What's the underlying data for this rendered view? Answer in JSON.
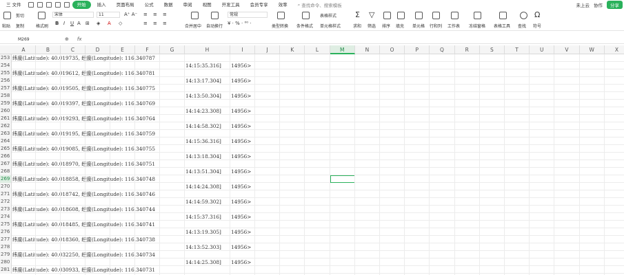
{
  "menu": {
    "items": [
      "三 文件",
      "开始",
      "插入",
      "页面布局",
      "公式",
      "数据",
      "审阅",
      "视图",
      "开发工具",
      "会员专享",
      "效率"
    ],
    "active_index": 1,
    "search_placeholder": "查找命令、搜索模板",
    "cloud": "未上云",
    "collab": "协作",
    "share": "分享"
  },
  "ribbon": {
    "paste": "粘贴",
    "cut": "剪切",
    "copy": "复制",
    "format_painter": "格式刷",
    "font_name": "宋体",
    "font_size": "11",
    "merge": "合并居中",
    "wrap": "自动换行",
    "number_format": "常规",
    "type_convert": "类型转换",
    "conditional_format": "条件格式",
    "table_style": "表格样式",
    "cell_style": "单元格样式",
    "sum": "求和",
    "filter": "筛选",
    "sort": "排序",
    "fill": "填充",
    "cell": "单元格",
    "row_col": "行和列",
    "worksheet": "工作表",
    "freeze": "冻结窗格",
    "table_tools": "表格工具",
    "find": "查找",
    "symbol": "符号"
  },
  "formula_bar": {
    "name_box": "M269",
    "fx": "fx",
    "value": ""
  },
  "columns": [
    "A",
    "B",
    "C",
    "D",
    "E",
    "F",
    "G",
    "H",
    "I",
    "J",
    "K",
    "L",
    "M",
    "N",
    "O",
    "P",
    "Q",
    "R",
    "S",
    "T",
    "U",
    "V",
    "W",
    "X"
  ],
  "selected_column": "M",
  "selected_row": "269",
  "rows": [
    {
      "n": "253",
      "a": "纬度(Latitude): 40.019735, 经度(Longitude): 116.340787",
      "h": "",
      "i": ""
    },
    {
      "n": "254",
      "a": "",
      "h": "14:15:35.316]",
      "i": "14956>"
    },
    {
      "n": "255",
      "a": "纬度(Latitude): 40.019612, 经度(Longitude): 116.340781",
      "h": "",
      "i": ""
    },
    {
      "n": "256",
      "a": "",
      "h": "14:13:17.304]",
      "i": "14956>"
    },
    {
      "n": "257",
      "a": "纬度(Latitude): 40.019505, 经度(Longitude): 116.340775",
      "h": "",
      "i": ""
    },
    {
      "n": "258",
      "a": "",
      "h": "14:13:50.304]",
      "i": "14956>"
    },
    {
      "n": "259",
      "a": "纬度(Latitude): 40.019397, 经度(Longitude): 116.340769",
      "h": "",
      "i": ""
    },
    {
      "n": "260",
      "a": "",
      "h": "14:14:23.308]",
      "i": "14956>"
    },
    {
      "n": "261",
      "a": "纬度(Latitude): 40.019293, 经度(Longitude): 116.340764",
      "h": "",
      "i": ""
    },
    {
      "n": "262",
      "a": "",
      "h": "14:14:58.302]",
      "i": "14956>"
    },
    {
      "n": "263",
      "a": "纬度(Latitude): 40.019195, 经度(Longitude): 116.340759",
      "h": "",
      "i": ""
    },
    {
      "n": "264",
      "a": "",
      "h": "14:15:36.316]",
      "i": "14956>"
    },
    {
      "n": "265",
      "a": "纬度(Latitude): 40.019085, 经度(Longitude): 116.340755",
      "h": "",
      "i": ""
    },
    {
      "n": "266",
      "a": "",
      "h": "14:13:18.304]",
      "i": "14956>"
    },
    {
      "n": "267",
      "a": "纬度(Latitude): 40.018970, 经度(Longitude): 116.340751",
      "h": "",
      "i": ""
    },
    {
      "n": "268",
      "a": "",
      "h": "14:13:51.304]",
      "i": "14956>"
    },
    {
      "n": "269",
      "a": "纬度(Latitude): 40.018858, 经度(Longitude): 116.340748",
      "h": "",
      "i": ""
    },
    {
      "n": "270",
      "a": "",
      "h": "14:14:24.308]",
      "i": "14956>"
    },
    {
      "n": "271",
      "a": "纬度(Latitude): 40.018742, 经度(Longitude): 116.340746",
      "h": "",
      "i": ""
    },
    {
      "n": "272",
      "a": "",
      "h": "14:14:59.302]",
      "i": "14956>"
    },
    {
      "n": "273",
      "a": "纬度(Latitude): 40.018608, 经度(Longitude): 116.340744",
      "h": "",
      "i": ""
    },
    {
      "n": "274",
      "a": "",
      "h": "14:15:37.316]",
      "i": "14956>"
    },
    {
      "n": "275",
      "a": "纬度(Latitude): 40.018485, 经度(Longitude): 116.340741",
      "h": "",
      "i": ""
    },
    {
      "n": "276",
      "a": "",
      "h": "14:13:19.305]",
      "i": "14956>"
    },
    {
      "n": "277",
      "a": "纬度(Latitude): 40.018360, 经度(Longitude): 116.340738",
      "h": "",
      "i": ""
    },
    {
      "n": "278",
      "a": "",
      "h": "14:13:52.303]",
      "i": "14956>"
    },
    {
      "n": "279",
      "a": "纬度(Latitude): 40.032250, 经度(Longitude): 116.340734",
      "h": "",
      "i": ""
    },
    {
      "n": "280",
      "a": "",
      "h": "14:14:25.308]",
      "i": "14956>"
    },
    {
      "n": "281",
      "a": "纬度(Latitude): 40.030933, 经度(Longitude): 116.340731",
      "h": "",
      "i": ""
    }
  ]
}
